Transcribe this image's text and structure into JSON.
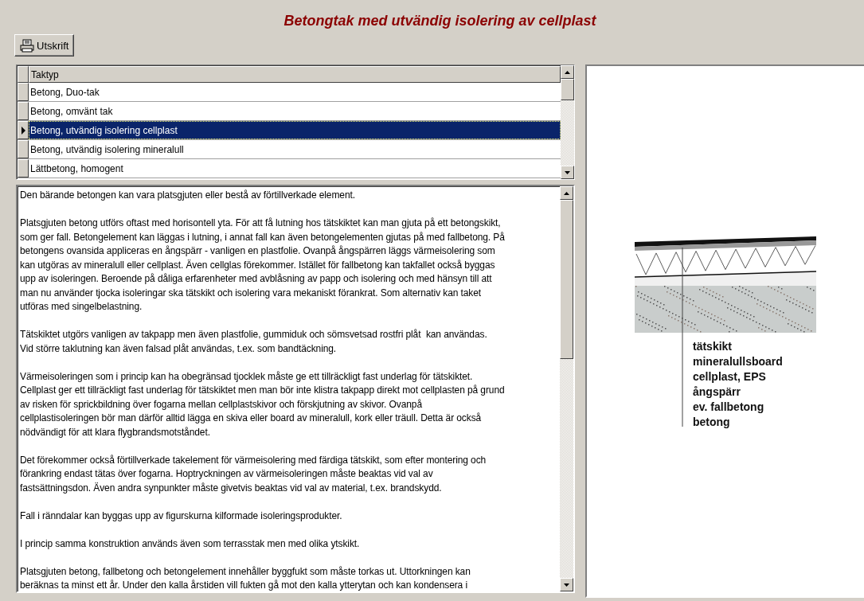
{
  "title": "Betongtak med utvändig isolering av cellplast",
  "print_button": {
    "label": "Utskrift"
  },
  "grid": {
    "column": "Taktyp",
    "rows": [
      {
        "label": "Betong, Duo-tak",
        "selected": false
      },
      {
        "label": "Betong, omvänt tak",
        "selected": false
      },
      {
        "label": "Betong, utvändig isolering cellplast",
        "selected": true
      },
      {
        "label": "Betong, utvändig isolering mineralull",
        "selected": false
      },
      {
        "label": "Lättbetong, homogent",
        "selected": false
      }
    ]
  },
  "description": [
    "Den bärande betongen kan vara platsgjuten eller bestå av förtillverkade element.",
    "Platsgjuten betong utförs oftast med horisontell yta. För att få lutning hos tätskiktet kan man gjuta på ett betongskikt,\nsom ger fall. Betongelement kan läggas i lutning, i annat fall kan även betongelementen gjutas på med fallbetong. På\nbetongens ovansida appliceras en ångspärr - vanligen en plastfolie. Ovanpå ångspärren läggs värmeisolering som\nkan utgöras av mineralull eller cellplast. Även cellglas förekommer. Istället för fallbetong kan takfallet också byggas\nupp av isoleringen. Beroende på dåliga erfarenheter med avblåsning av papp och isolering och med hänsyn till att\nman nu använder tjocka isoleringar ska tätskikt och isolering vara mekaniskt förankrat. Som alternativ kan taket\nutföras med singelbelastning.",
    "Tätskiktet utgörs vanligen av takpapp men även plastfolie, gummiduk och sömsvetsad rostfri plåt  kan användas.\nVid större taklutning kan även falsad plåt användas, t.ex. som bandtäckning.",
    "Värmeisoleringen som i princip kan ha obegränsad tjocklek måste ge ett tillräckligt fast underlag för tätskiktet.\nCellplast ger ett tillräckligt fast underlag för tätskiktet men man bör inte klistra takpapp direkt mot cellplasten på grund\nav risken för sprickbildning över fogarna mellan cellplastskivor och förskjutning av skivor. Ovanpå\ncellplastisoleringen bör man därför alltid lägga en skiva eller board av mineralull, kork eller träull. Detta är också\nnödvändigt för att klara flygbrandsmotståndet.",
    "Det förekommer också förtillverkade takelement för värmeisolering med färdiga tätskikt, som efter montering och\nförankring endast tätas över fogarna. Hoptryckningen av värmeisoleringen måste beaktas vid val av\nfastsättningsdon. Även andra synpunkter måste givetvis beaktas vid val av material, t.ex. brandskydd.",
    "Fall i ränndalar kan byggas upp av figurskurna kilformade isoleringsprodukter.",
    "I princip samma konstruktion används även som terrasstak men med olika ytskikt.",
    "Platsgjuten betong, fallbetong och betongelement innehåller byggfukt som måste torkas ut. Uttorkningen kan\nberäknas ta minst ett år. Under den kalla årstiden vill fukten gå mot den kalla ytterytan och kan kondensera i"
  ],
  "diagram": {
    "layers": [
      "tätskikt",
      "mineralullsboard",
      "cellplast, EPS",
      "ångspärr",
      "ev. fallbetong",
      "betong"
    ]
  }
}
